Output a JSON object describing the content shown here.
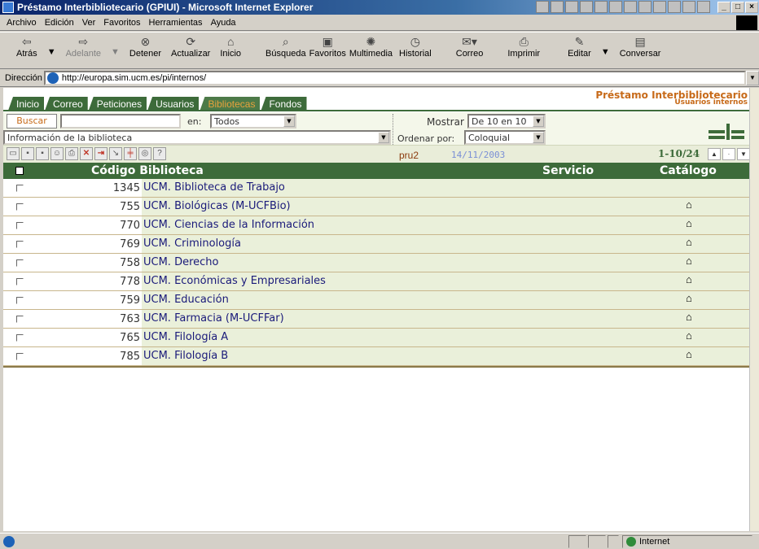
{
  "window": {
    "title": "Préstamo Interbibliotecario (GPIUI) - Microsoft Internet Explorer"
  },
  "menu": [
    "Archivo",
    "Edición",
    "Ver",
    "Favoritos",
    "Herramientas",
    "Ayuda"
  ],
  "toolbar": {
    "back": "Atrás",
    "forward": "Adelante",
    "stop": "Detener",
    "refresh": "Actualizar",
    "home": "Inicio",
    "search": "Búsqueda",
    "favorites": "Favoritos",
    "media": "Multimedia",
    "history": "Historial",
    "mail": "Correo",
    "print": "Imprimir",
    "edit": "Editar",
    "discuss": "Conversar"
  },
  "address": {
    "label": "Dirección",
    "url": "http://europa.sim.ucm.es/pi/internos/"
  },
  "app": {
    "brand": "Préstamo Interbibliotecario",
    "brand_sub": "Usuarios internos",
    "tabs": [
      "Inicio",
      "Correo",
      "Peticiones",
      "Usuarios",
      "Bibliotecas",
      "Fondos"
    ],
    "active_tab": "Bibliotecas",
    "search": {
      "button": "Buscar",
      "value": "",
      "en_label": "en:",
      "en_value": "Todos",
      "info_value": "Información de la biblioteca",
      "mostrar_label": "Mostrar",
      "mostrar_value": "De 10 en 10",
      "ordenar_label": "Ordenar por:",
      "ordenar_value": "Coloquial"
    },
    "actions": {
      "user": "pru2",
      "date": "14/11/2003",
      "page_info": "1-10/24"
    },
    "table": {
      "headers": {
        "code_library": "Código Biblioteca",
        "service": "Servicio",
        "catalog": "Catálogo"
      },
      "rows": [
        {
          "code": "1345",
          "name": "UCM. Biblioteca de Trabajo",
          "catalog": false
        },
        {
          "code": "755",
          "name": "UCM. Biológicas (M-UCFBio)",
          "catalog": true
        },
        {
          "code": "770",
          "name": "UCM. Ciencias de la Información",
          "catalog": true
        },
        {
          "code": "769",
          "name": "UCM. Criminología",
          "catalog": true
        },
        {
          "code": "758",
          "name": "UCM. Derecho",
          "catalog": true
        },
        {
          "code": "778",
          "name": "UCM. Económicas y Empresariales",
          "catalog": true
        },
        {
          "code": "759",
          "name": "UCM. Educación",
          "catalog": true
        },
        {
          "code": "763",
          "name": "UCM. Farmacia (M-UCFFar)",
          "catalog": true
        },
        {
          "code": "765",
          "name": "UCM. Filología A",
          "catalog": true
        },
        {
          "code": "785",
          "name": "UCM. Filología B",
          "catalog": true
        }
      ]
    }
  },
  "status": {
    "zone": "Internet"
  },
  "colors": {
    "accent_green": "#3d6b3a",
    "accent_orange": "#c76a19",
    "row_highlight": "#eaf0da"
  }
}
